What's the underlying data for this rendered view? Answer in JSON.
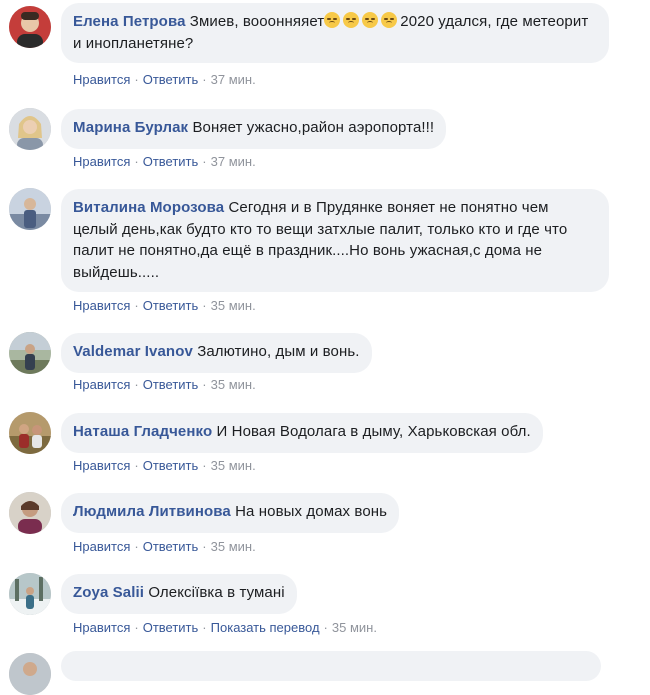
{
  "actions": {
    "like": "Нравится",
    "reply": "Ответить",
    "translate": "Показать перевод",
    "separator": "·"
  },
  "comments": [
    {
      "author": "Елена Петрова",
      "text_before": "Змиев, вооонняяет",
      "emoji": [
        "disappointed-face-icon",
        "disappointed-face-icon",
        "disappointed-face-icon",
        "disappointed-face-icon"
      ],
      "text_after": "2020 удался, где метеорит и инопланетяне?",
      "time": "37 мин."
    },
    {
      "author": "Марина Бурлак",
      "text": "Воняет ужасно,район аэропорта!!!",
      "time": "37 мин."
    },
    {
      "author": "Виталина Морозова",
      "text": "Сегодня и в Прудянке воняет не понятно чем целый день,как будто кто то вещи затхлые палит, только кто и где что палит не понятно,да ещё в праздник....Но вонь ужасная,с дома не выйдешь.....",
      "time": "35 мин."
    },
    {
      "author": "Valdemar Ivanov",
      "text": "Залютино, дым и вонь.",
      "time": "35 мин."
    },
    {
      "author": "Наташа Гладченко",
      "text": "И Новая Водолага в дыму, Харьковская обл.",
      "time": "35 мин."
    },
    {
      "author": "Людмила Литвинова",
      "text": "На новых домах вонь",
      "time": "35 мин."
    },
    {
      "author": "Zoya Salii",
      "text": "Олексіївка в тумані",
      "time": "35 мин."
    }
  ],
  "colors": {
    "author": "#385898",
    "bubble": "#f0f2f5",
    "text": "#1c1e21",
    "meta": "#90949c"
  }
}
